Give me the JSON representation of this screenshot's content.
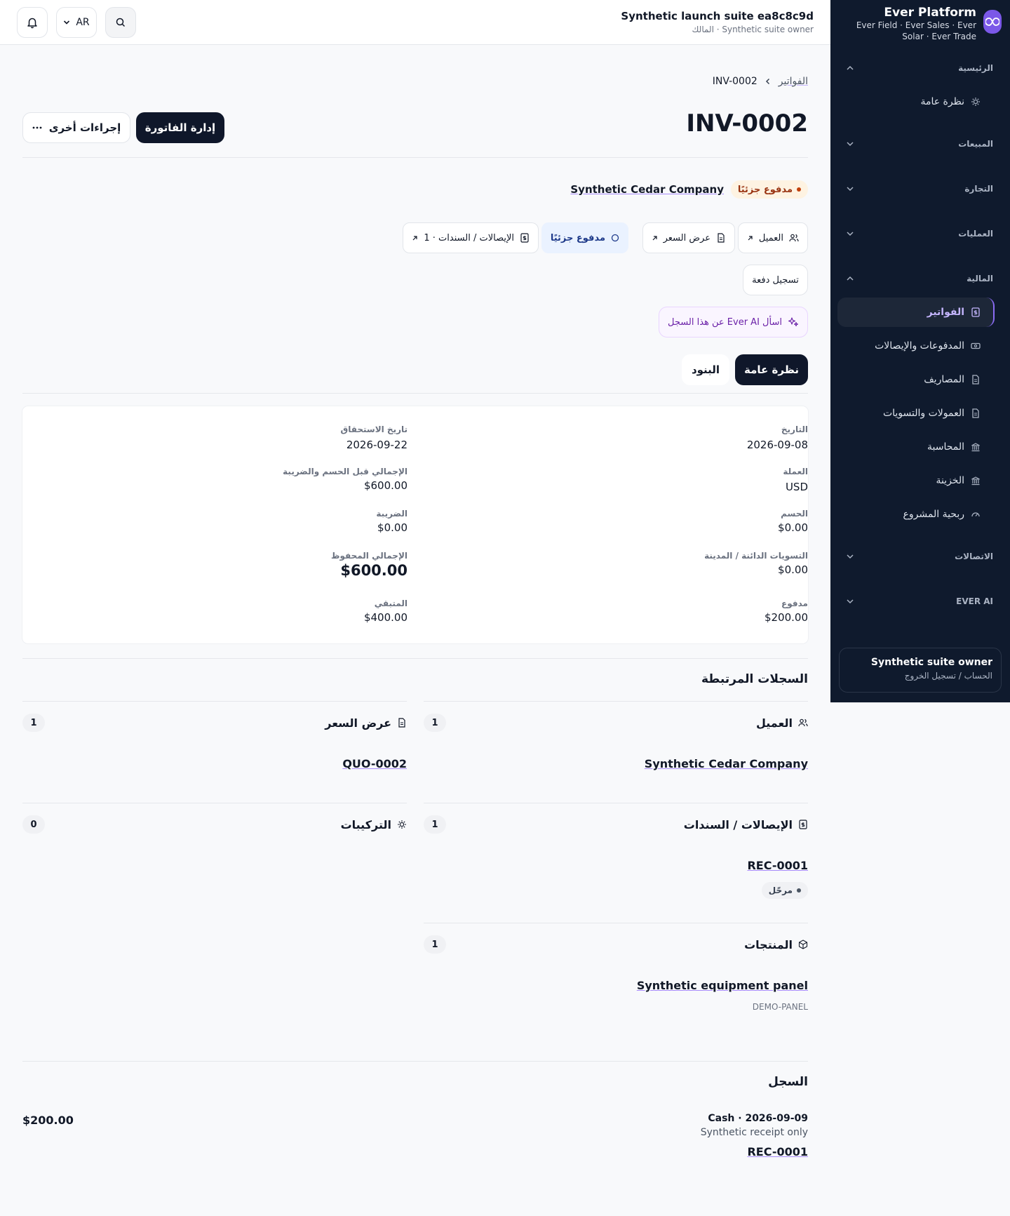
{
  "brand": {
    "title": "Ever Platform",
    "subtitle": "Ever Field · Ever Sales · Ever Solar · Ever Trade"
  },
  "sidebar": {
    "sections": {
      "home": "الرئيسية",
      "sales": "المبيعات",
      "commerce": "التجارة",
      "operations": "العمليات",
      "finance": "المالية",
      "contacts": "الاتصالات",
      "ai": "EVER AI"
    },
    "overview": "نظرة عامة",
    "finance_items": [
      "الفواتير",
      "المدفوعات والإيصالات",
      "المصاريف",
      "العمولات والتسويات",
      "المحاسبة",
      "الخزينة",
      "ربحية المشروع"
    ],
    "account": {
      "name": "Synthetic suite owner",
      "links": "الحساب / تسجيل الخروج"
    }
  },
  "topbar": {
    "language": "AR",
    "suite_title": "Synthetic launch suite ea8c8c9d",
    "suite_subtitle": "المالك · Synthetic suite owner"
  },
  "breadcrumb": {
    "parent": "الفواتير",
    "current": "INV-0002"
  },
  "invoice": {
    "number": "INV-0002",
    "manage_label": "إدارة الفاتورة",
    "more_label": "إجراءات أخرى",
    "status": "مدفوع جزئيًا",
    "company": "Synthetic Cedar Company",
    "chips": {
      "customer": "العميل",
      "quote": "عرض السعر",
      "paid_status": "مدفوع جزئيًا",
      "receipts": "الإيصالات / السندات · 1"
    },
    "record_payment": "تسجيل دفعة",
    "ask_ai": "اسأل Ever AI عن هذا السجل",
    "tabs": {
      "overview": "نظرة عامة",
      "items": "البنود"
    }
  },
  "details": {
    "date_label": "التاريخ",
    "date": "2026-09-08",
    "due_label": "تاريخ الاستحقاق",
    "due": "2026-09-22",
    "currency_label": "العملة",
    "currency": "USD",
    "subtotal_label": "الإجمالي قبل الحسم والضريبة",
    "subtotal": "$600.00",
    "discount_label": "الحسم",
    "discount": "$0.00",
    "tax_label": "الضريبة",
    "tax": "$0.00",
    "credits_label": "التسويات الدائنة / المدينة",
    "credits": "$0.00",
    "total_label": "الإجمالي المحفوظ",
    "total": "$600.00",
    "paid_label": "مدفوع",
    "paid": "$200.00",
    "remaining_label": "المتبقي",
    "remaining": "$400.00"
  },
  "related": {
    "title": "السجلات المرتبطة",
    "customer": {
      "label": "العميل",
      "count": "1",
      "link": "Synthetic Cedar Company"
    },
    "quote": {
      "label": "عرض السعر",
      "count": "1",
      "link": "QUO-0002"
    },
    "receipts": {
      "label": "الإيصالات / السندات",
      "count": "1",
      "link": "REC-0001",
      "status": "مرحّل"
    },
    "installations": {
      "label": "التركيبات",
      "count": "0"
    },
    "products": {
      "label": "المنتجات",
      "count": "1",
      "link": "Synthetic equipment panel",
      "sku": "DEMO-PANEL"
    }
  },
  "log": {
    "title": "السجل",
    "entry_title": "Cash · 2026-09-09",
    "entry_sub": "Synthetic receipt only",
    "entry_link": "REC-0001",
    "amount": "$200.00"
  },
  "colors": {
    "sidebar_bg": "#0f1a2d",
    "accent": "#8b6cf3",
    "primary_button": "#0f172a",
    "status_partial_bg": "#fef3e2",
    "status_partial_text": "#9a3412",
    "paid_chip_bg": "#eaf2ff"
  },
  "icons": [
    "bell-icon",
    "chevron-down-icon",
    "search-icon",
    "brand-logo-icon",
    "gear-icon",
    "invoice-icon",
    "wallet-icon",
    "document-icon",
    "bank-icon",
    "gauge-icon",
    "users-icon",
    "external-link-icon",
    "circle-icon",
    "sparkles-icon",
    "box-icon",
    "ellipsis-icon",
    "chevron-left-icon"
  ]
}
